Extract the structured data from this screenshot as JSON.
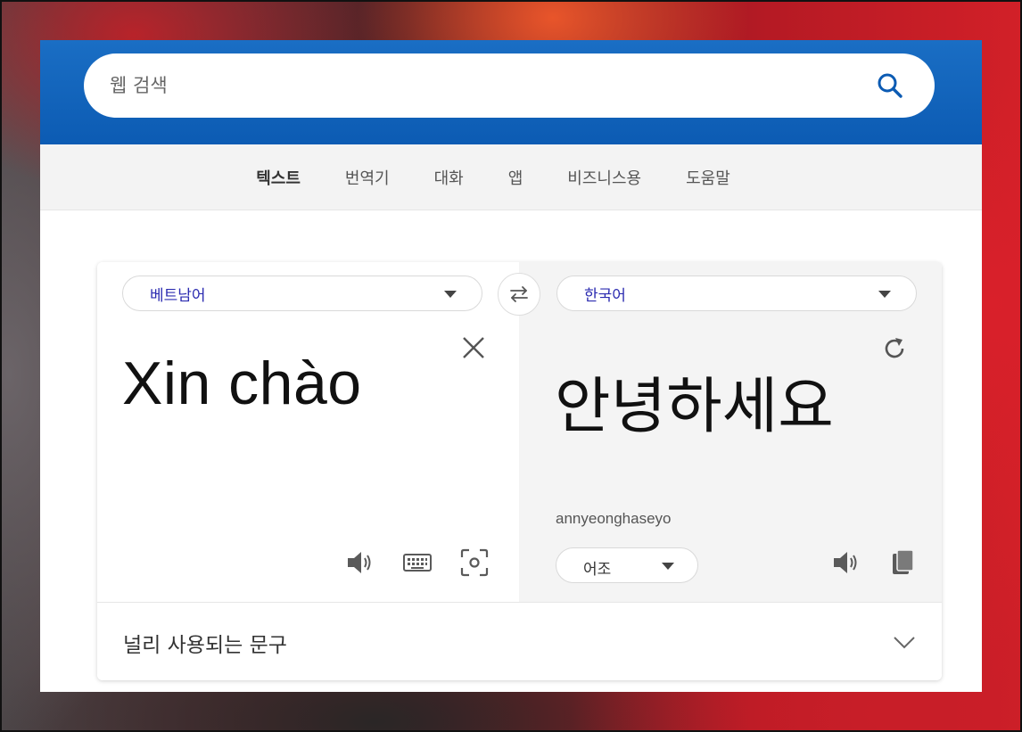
{
  "search": {
    "placeholder": "웹 검색",
    "search_icon": "search-icon"
  },
  "nav": {
    "items": [
      {
        "label": "텍스트",
        "active": true
      },
      {
        "label": "번역기",
        "active": false
      },
      {
        "label": "대화",
        "active": false
      },
      {
        "label": "앱",
        "active": false
      },
      {
        "label": "비즈니스용",
        "active": false
      },
      {
        "label": "도움말",
        "active": false
      }
    ]
  },
  "translator": {
    "source_lang": "베트남어",
    "target_lang": "한국어",
    "source_text": "Xin chào",
    "target_text": "안녕하세요",
    "transliteration": "annyeonghaseyo",
    "tone": "어조",
    "icons": {
      "swap": "swap-arrows-icon",
      "clear": "close-icon",
      "refresh": "refresh-icon",
      "speaker": "speaker-icon",
      "keyboard": "keyboard-icon",
      "camera": "camera-scan-icon",
      "copy": "copy-icon"
    }
  },
  "phrases": {
    "label": "널리 사용되는 문구"
  },
  "colors": {
    "header_blue": "#0c5bb3",
    "lang_text": "#2b2bb0",
    "target_pane_bg": "#f4f4f4"
  }
}
